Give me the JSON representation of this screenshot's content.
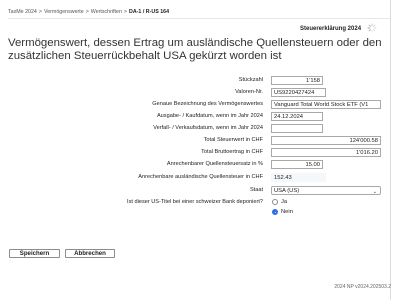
{
  "breadcrumb": {
    "items": [
      "TaxMe 2024",
      "Vermögenswerte",
      "Wertschriften"
    ],
    "current": "DA-1 / R-US 164",
    "separator": ">"
  },
  "header": {
    "form_title": "Steuererklärung 2024"
  },
  "page_title": "Vermögenswert, dessen Ertrag um ausländische Quellensteuern oder den zusätzlichen Steuerrückbehalt USA gekürzt worden ist",
  "form": {
    "stueckzahl": {
      "label": "Stückzahl",
      "value": "1'158"
    },
    "valoren": {
      "label": "Valoren-Nr.",
      "value": "US9220427424"
    },
    "bezeichnung": {
      "label": "Genaue Bezeichnung des Vermögenswertes",
      "value": "Vanguard Total World Stock ETF (V1"
    },
    "kaufdatum": {
      "label": "Ausgabe- / Kaufdatum, wenn im Jahr 2024",
      "value": "24.12.2024"
    },
    "verkaufsdatum": {
      "label": "Verfall- / Verkaufsdatum, wenn im Jahr 2024",
      "value": ""
    },
    "steuerwert": {
      "label": "Total Steuerwert in CHF",
      "value": "124'000.58"
    },
    "bruttoertrag": {
      "label": "Total Bruttoertrag in CHF",
      "value": "1'016.20"
    },
    "quellensteuersatz": {
      "label": "Anrechenbarer Quellensteuersatz in %",
      "value": "15.00"
    },
    "quellensteuer": {
      "label": "Anrechenbare ausländische Quellensteuer in CHF",
      "value": "152.43"
    },
    "staat": {
      "label": "Staat",
      "value": "USA (US)"
    },
    "deponiert": {
      "label": "Ist dieser US-Titel bei einer schweizer Bank deponiert?",
      "options": [
        "Ja",
        "Nein"
      ],
      "selected": "Nein"
    }
  },
  "buttons": {
    "save": "Speichern",
    "cancel": "Abbrechen"
  },
  "footer": "2024 NP v2024.202503.2"
}
